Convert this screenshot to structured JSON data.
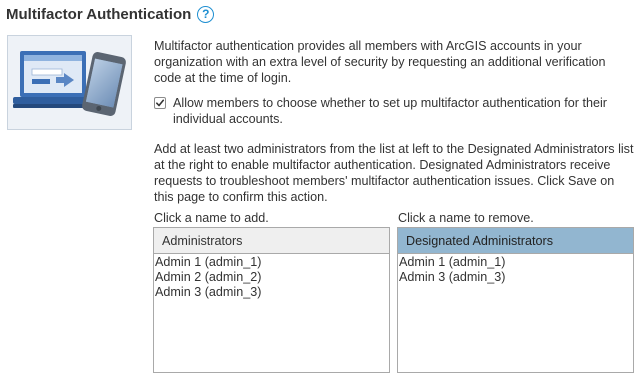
{
  "section": {
    "title": "Multifactor Authentication",
    "help_glyph": "?"
  },
  "intro_text": "Multifactor authentication provides all members with ArcGIS accounts in your organization with an extra level of security by requesting an additional verification code at the time of login.",
  "allow_member_setup": {
    "checked": true,
    "label": "Allow members to choose whether to set up multifactor authentication for their individual accounts."
  },
  "instructions_text": "Add at least two administrators from the list at left to the Designated Administrators list at the right to enable multifactor authentication. Designated Administrators receive requests to troubleshoot members' multifactor authentication issues. Click Save on this page to confirm this action.",
  "administrators": {
    "hint": "Click a name to add.",
    "header": "Administrators",
    "items": [
      "Admin 1 (admin_1)",
      "Admin 2 (admin_2)",
      "Admin 3 (admin_3)"
    ]
  },
  "designated_administrators": {
    "hint": "Click a name to remove.",
    "header": "Designated Administrators",
    "items": [
      "Admin 1 (admin_1)",
      "Admin 3 (admin_3)"
    ]
  },
  "colors": {
    "help_icon": "#1f8fd1",
    "designated_header_bg": "#92b6d0",
    "administrators_header_bg": "#efefef"
  }
}
